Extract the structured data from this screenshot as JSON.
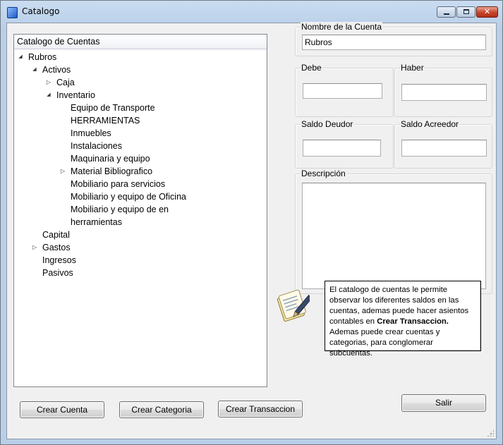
{
  "window": {
    "title": "Catalogo",
    "minimize_icon": "minimize-icon",
    "maximize_icon": "maximize-icon",
    "close_icon": "close-icon",
    "close_glyph": "✕"
  },
  "tree": {
    "header": "Catalogo de Cuentas",
    "nodes": [
      {
        "label": "Rubros",
        "level": 0,
        "toggle": "expanded"
      },
      {
        "label": "Activos",
        "level": 1,
        "toggle": "expanded"
      },
      {
        "label": "Caja",
        "level": 2,
        "toggle": "collapsed"
      },
      {
        "label": "Inventario",
        "level": 2,
        "toggle": "expanded"
      },
      {
        "label": "Equipo de Transporte",
        "level": 3,
        "toggle": "none"
      },
      {
        "label": "HERRAMIENTAS",
        "level": 3,
        "toggle": "none"
      },
      {
        "label": "Inmuebles",
        "level": 3,
        "toggle": "none"
      },
      {
        "label": "Instalaciones",
        "level": 3,
        "toggle": "none"
      },
      {
        "label": "Maquinaria y equipo",
        "level": 3,
        "toggle": "none"
      },
      {
        "label": "Material Bibliografico",
        "level": 3,
        "toggle": "collapsed"
      },
      {
        "label": "Mobiliario para servicios",
        "level": 3,
        "toggle": "none"
      },
      {
        "label": "Mobiliario y equipo de Oficina",
        "level": 3,
        "toggle": "none"
      },
      {
        "label": "Mobiliario y equipo de en",
        "level": 3,
        "toggle": "none"
      },
      {
        "label": "herramientas",
        "level": 3,
        "toggle": "none"
      },
      {
        "label": "Capital",
        "level": 1,
        "toggle": "none"
      },
      {
        "label": "Gastos",
        "level": 1,
        "toggle": "collapsed"
      },
      {
        "label": "Ingresos",
        "level": 1,
        "toggle": "none"
      },
      {
        "label": "Pasivos",
        "level": 1,
        "toggle": "none"
      }
    ]
  },
  "fields": {
    "nombre_label": "Nombre de la Cuenta",
    "nombre_value": "Rubros",
    "debe_label": "Debe",
    "debe_value": "",
    "haber_label": "Haber",
    "haber_value": "",
    "saldo_deudor_label": "Saldo Deudor",
    "saldo_deudor_value": "",
    "saldo_acreedor_label": "Saldo Acreedor",
    "saldo_acreedor_value": "",
    "descripcion_label": "Descripción",
    "descripcion_value": ""
  },
  "info": {
    "icon": "document-pen-icon",
    "text_before": "El catalogo de cuentas le permite observar los diferentes saldos en las cuentas, ademas puede hacer asientos contables en ",
    "text_bold": "Crear Transaccion.",
    "text_after": " Ademas puede crear cuentas y categorias, para conglomerar subcuentas."
  },
  "buttons": {
    "crear_cuenta": "Crear Cuenta",
    "crear_categoria": "Crear Categoria",
    "crear_transaccion": "Crear Transaccion",
    "salir": "Salir"
  }
}
